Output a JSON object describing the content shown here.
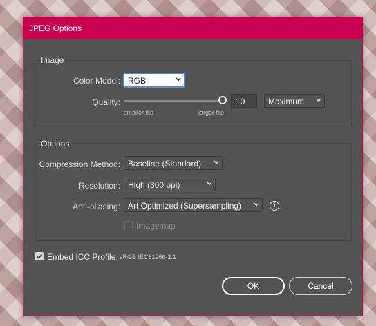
{
  "dialog": {
    "title": "JPEG Options",
    "accent_color": "#c8004f"
  },
  "image_group": {
    "label": "Image",
    "color_model_label": "Color Model:",
    "color_model_value": "RGB",
    "quality_label": "Quality:",
    "quality_value": "10",
    "quality_level": 1.0,
    "quality_preset": "Maximum",
    "slider_left_caption": "smaller file",
    "slider_right_caption": "larger file"
  },
  "options_group": {
    "label": "Options",
    "compression_label": "Compression Method:",
    "compression_value": "Baseline (Standard)",
    "resolution_label": "Resolution:",
    "resolution_value": "High (300 ppi)",
    "antialiasing_label": "Anti-aliasing:",
    "antialiasing_value": "Art Optimized (Supersampling)",
    "imagemap_label": "Imagemap",
    "imagemap_checked": false,
    "imagemap_enabled": false
  },
  "icc": {
    "label": "Embed ICC Profile:",
    "profile": "sRGB IEC61966-2.1",
    "checked": true
  },
  "buttons": {
    "ok": "OK",
    "cancel": "Cancel"
  },
  "icons": {
    "chevron": "chevron-down-icon",
    "info": "info-icon",
    "check": "checkmark-icon"
  }
}
